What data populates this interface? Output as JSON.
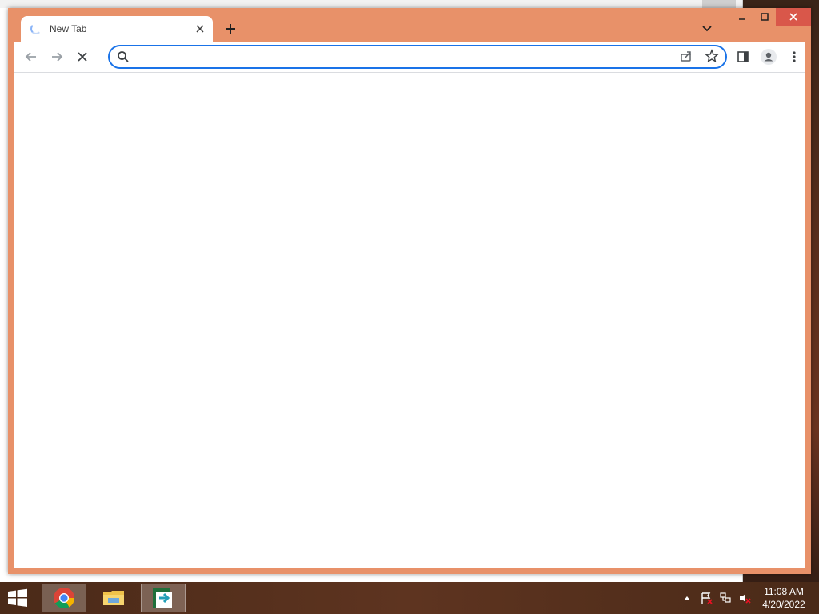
{
  "browser": {
    "tab": {
      "title": "New Tab"
    },
    "omnibox": {
      "value": "",
      "placeholder": ""
    },
    "accent": "#e89169"
  },
  "taskbar": {
    "apps": [
      {
        "name": "Google Chrome",
        "icon": "chrome-icon",
        "active": true
      },
      {
        "name": "File Explorer",
        "icon": "folder-icon",
        "active": false
      },
      {
        "name": "Remote Desktop",
        "icon": "remote-app-icon",
        "active": true
      }
    ],
    "clock": {
      "time": "11:08 AM",
      "date": "4/20/2022"
    }
  }
}
